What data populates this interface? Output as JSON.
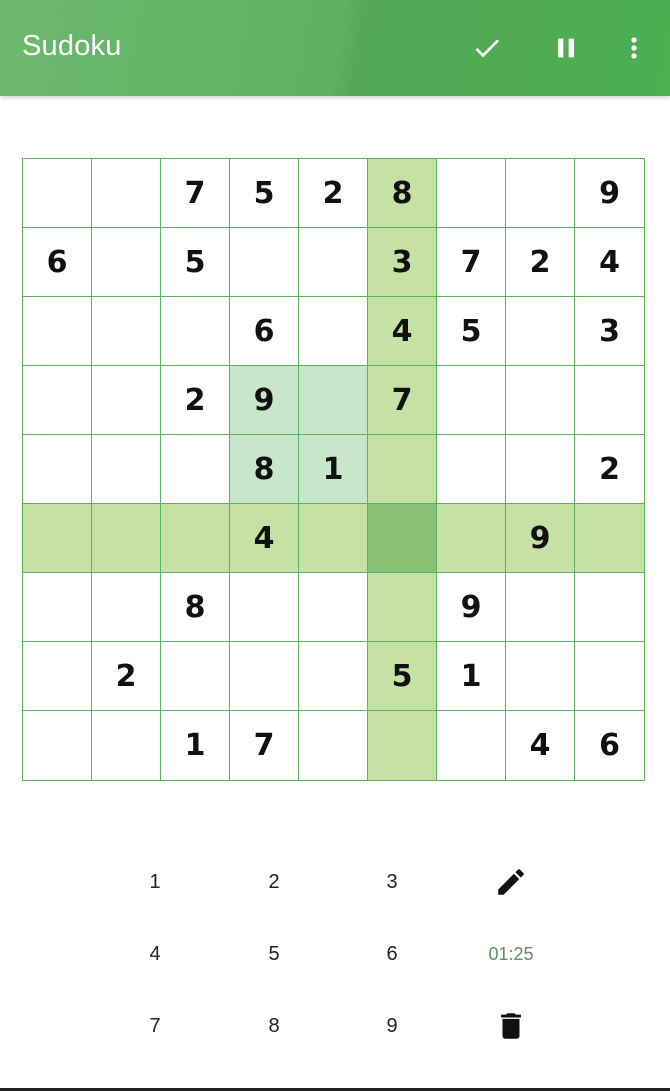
{
  "appbar": {
    "title": "Sudoku",
    "icons": [
      "check-icon",
      "pause-icon",
      "more-vert-icon"
    ]
  },
  "colors": {
    "primary": "#4caf50",
    "highlight": "#c8e6c9",
    "highlight_box": "#c5e1a5",
    "selected": "#88c074",
    "grid_line": "#5fb262"
  },
  "board": {
    "grid": [
      [
        "",
        "",
        "7",
        "5",
        "2",
        "8",
        "",
        "",
        "9"
      ],
      [
        "6",
        "",
        "5",
        "",
        "",
        "3",
        "7",
        "2",
        "4"
      ],
      [
        "",
        "",
        "",
        "6",
        "",
        "4",
        "5",
        "",
        "3"
      ],
      [
        "",
        "",
        "2",
        "9",
        "",
        "7",
        "",
        "",
        ""
      ],
      [
        "",
        "",
        "",
        "8",
        "1",
        "",
        "",
        "",
        "2"
      ],
      [
        "",
        "",
        "",
        "4",
        "",
        "",
        "",
        "9",
        ""
      ],
      [
        "",
        "",
        "8",
        "",
        "",
        "",
        "9",
        "",
        ""
      ],
      [
        "",
        "2",
        "",
        "",
        "",
        "5",
        "1",
        "",
        ""
      ],
      [
        "",
        "",
        "1",
        "7",
        "",
        "",
        "",
        "4",
        "6"
      ]
    ],
    "selected_cell": [
      5,
      5
    ]
  },
  "keypad": {
    "numbers": [
      "1",
      "2",
      "3",
      "4",
      "5",
      "6",
      "7",
      "8",
      "9"
    ],
    "timer": "01:25",
    "icons": [
      "pencil-icon",
      "trash-icon"
    ]
  }
}
